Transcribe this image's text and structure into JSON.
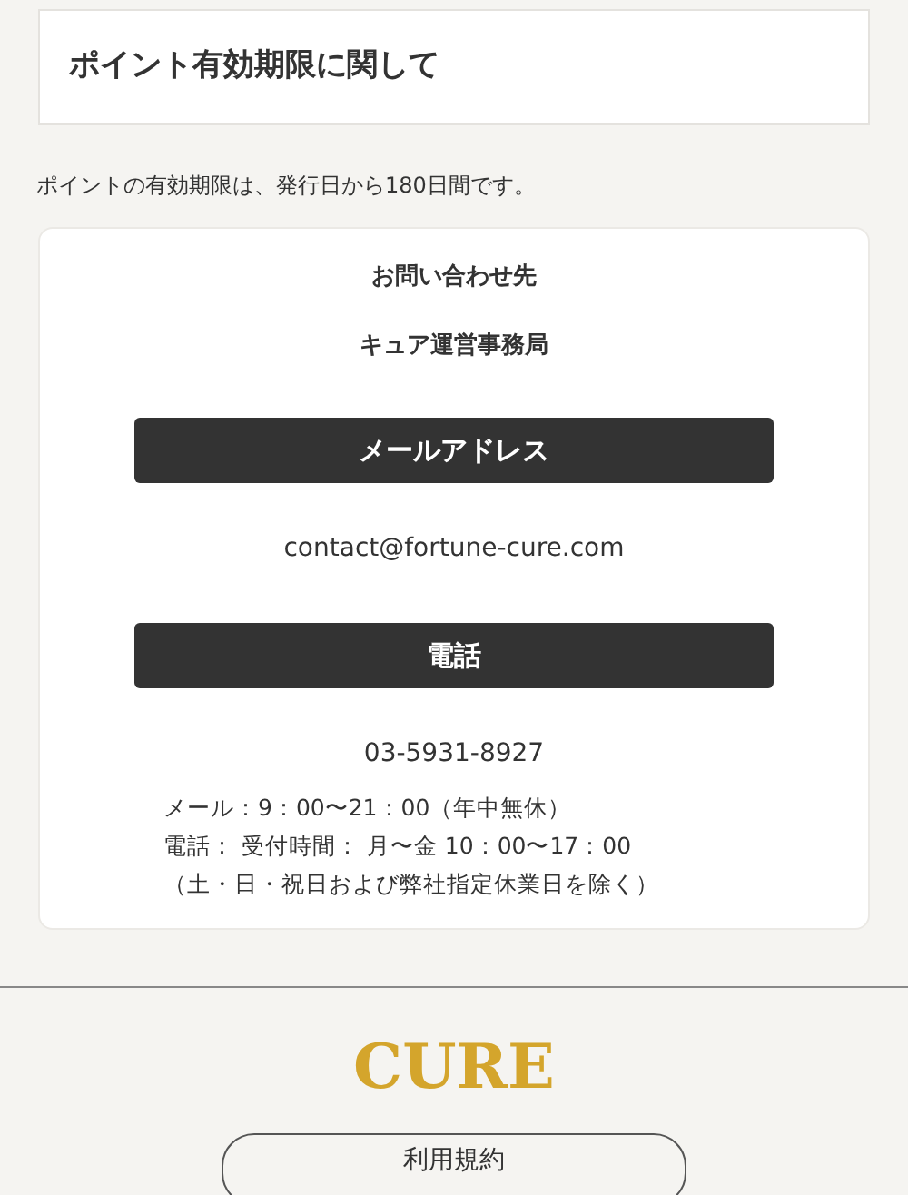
{
  "section_title": "ポイント有効期限に関して",
  "section_text": "ポイントの有効期限は、発行日から180日間です。",
  "contact": {
    "title": "お問い合わせ先",
    "organization": "キュア運営事務局",
    "blocks": [
      {
        "heading": "メールアドレス",
        "value": "contact@fortune-cure.com"
      },
      {
        "heading": "電話",
        "value": "03-5931-8927"
      }
    ],
    "hours": [
      "メール：9：00〜21：00（年中無休）",
      "電話： 受付時間： 月〜金 10：00〜17：00",
      "（土・日・祝日および弊社指定休業日を除く）"
    ]
  },
  "footer": {
    "logo": "CURE",
    "links": [
      "利用規約"
    ]
  }
}
